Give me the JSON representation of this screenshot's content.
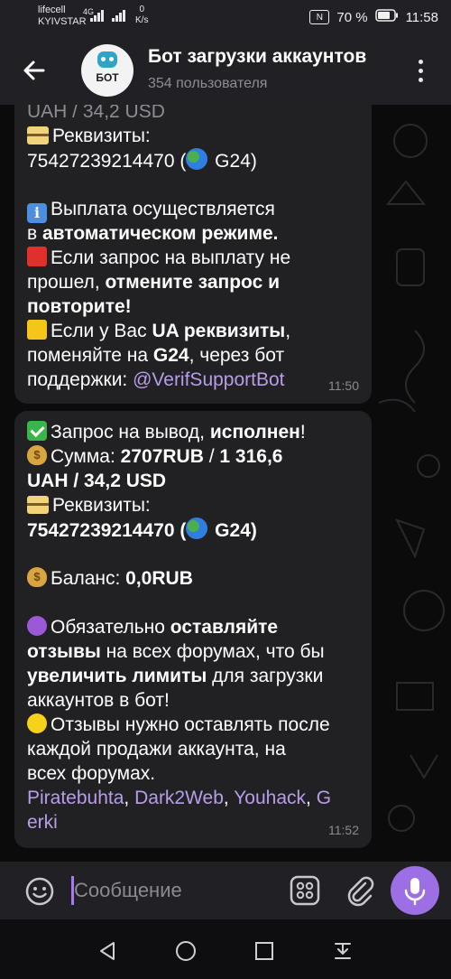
{
  "status": {
    "carrier1": "lifecell",
    "carrier2": "KYIVSTAR",
    "network": "4G",
    "speed_value": "0",
    "speed_unit": "K/s",
    "battery": "70 %",
    "time": "11:58",
    "nfc_label": "N"
  },
  "header": {
    "title": "Бот загрузки аккаунтов",
    "subtitle": "354 пользователя",
    "avatar_text": "БОТ"
  },
  "messages": [
    {
      "partial_top": "UAH / 34,2 USD",
      "reqs_label": "Реквизиты:",
      "reqs_number": "75427239214470 (",
      "reqs_suffix": " G24)",
      "info_1": "Выплата осуществляется",
      "info_2a": "в ",
      "info_2b": "автоматическом режиме.",
      "red_1": "Если запрос на выплату не",
      "red_2a": "прошел, ",
      "red_2b": "отмените запрос и",
      "red_3": "повторите!",
      "yellow_1a": "Если у Вас ",
      "yellow_1b": "UA реквизиты",
      "yellow_1c": ",",
      "yellow_2a": "поменяйте на ",
      "yellow_2b": "G24",
      "yellow_2c": ", через бот",
      "yellow_3a": "поддержки: ",
      "yellow_3b": "@VerifSupportBot",
      "time": "11:50"
    },
    {
      "req_1a": "Запрос на вывод, ",
      "req_1b": "исполнен",
      "req_1c": "!",
      "sum_1a": "Сумма: ",
      "sum_1b": "2707RUB",
      "sum_1c": "  / ",
      "sum_1d": "1 316,6",
      "sum_2": "UAH / 34,2 USD",
      "reqs_label": "Реквизиты:",
      "reqs_number": "75427239214470 (",
      "reqs_suffix": " G24)",
      "bal_a": "Баланс: ",
      "bal_b": "0,0RUB",
      "p_1a": "Обязательно ",
      "p_1b": "оставляйте",
      "p_2a": "отзывы",
      "p_2b": " на всех форумах, что бы",
      "p_3a": "увеличить лимиты",
      "p_3b": " для загрузки",
      "p_4": "аккаунтов в бот!",
      "y_1": "Отзывы нужно оставлять после",
      "y_2": "каждой продажи аккаунта, на",
      "y_3": "всех форумах.",
      "links": [
        "Piratebuhta",
        "Dark2Web",
        "Youhack",
        "Gerki"
      ],
      "sep": ", ",
      "gerki_1": "G",
      "gerki_2": "erki",
      "time": "11:52"
    }
  ],
  "input": {
    "placeholder": "Сообщение"
  },
  "colors": {
    "accent": "#9c6fe4",
    "link": "#b89ee8",
    "bubble": "#212023",
    "header": "#212024"
  }
}
